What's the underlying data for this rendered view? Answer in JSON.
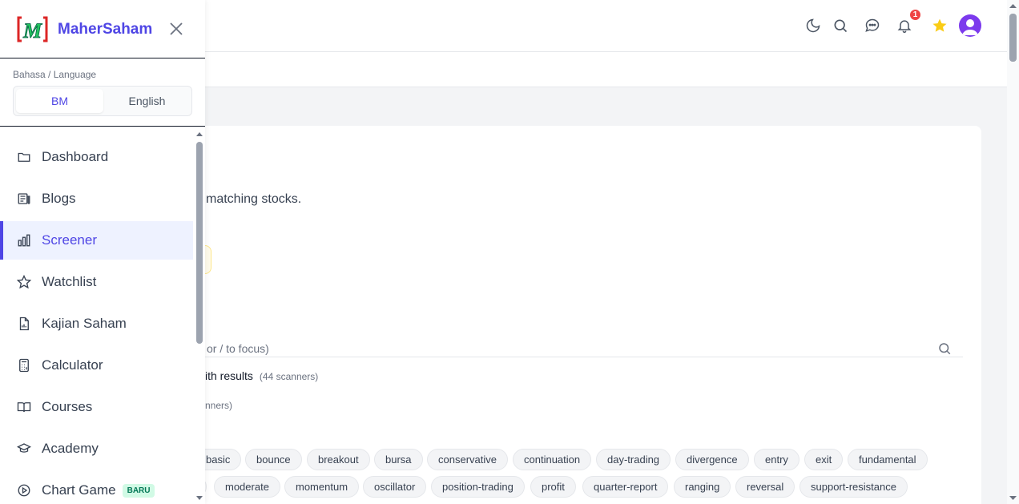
{
  "brand": {
    "name": "MaherSaham",
    "logo_letter": "M"
  },
  "language": {
    "label": "Bahasa / Language",
    "options": [
      "BM",
      "English"
    ],
    "selected": "BM"
  },
  "nav": [
    {
      "label": "Dashboard",
      "icon": "folder-icon"
    },
    {
      "label": "Blogs",
      "icon": "newspaper-icon"
    },
    {
      "label": "Screener",
      "icon": "bar-chart-icon",
      "active": true
    },
    {
      "label": "Watchlist",
      "icon": "star-icon"
    },
    {
      "label": "Kajian Saham",
      "icon": "report-icon"
    },
    {
      "label": "Calculator",
      "icon": "calculator-icon"
    },
    {
      "label": "Courses",
      "icon": "book-icon"
    },
    {
      "label": "Academy",
      "icon": "graduation-cap-icon"
    },
    {
      "label": "Chart Game",
      "icon": "play-circle-icon",
      "badge": "BARU"
    }
  ],
  "header": {
    "notification_count": "1"
  },
  "main": {
    "intro_fragment": "matching stocks.",
    "search_placeholder_fragment": "or / to focus)",
    "results_fragment": "ith results",
    "results_count": "(44 scanners)",
    "scanners_fragment": "nners)"
  },
  "tags_row1": [
    "basic",
    "bounce",
    "breakout",
    "bursa",
    "conservative",
    "continuation",
    "day-trading",
    "divergence",
    "entry",
    "exit",
    "fundamental"
  ],
  "tags_row2": [
    "moderate",
    "momentum",
    "oscillator",
    "position-trading",
    "profit",
    "quarter-report",
    "ranging",
    "reversal",
    "support-resistance"
  ],
  "colors": {
    "accent": "#4f46e5",
    "star": "#facc15",
    "badge": "#ef4444"
  }
}
